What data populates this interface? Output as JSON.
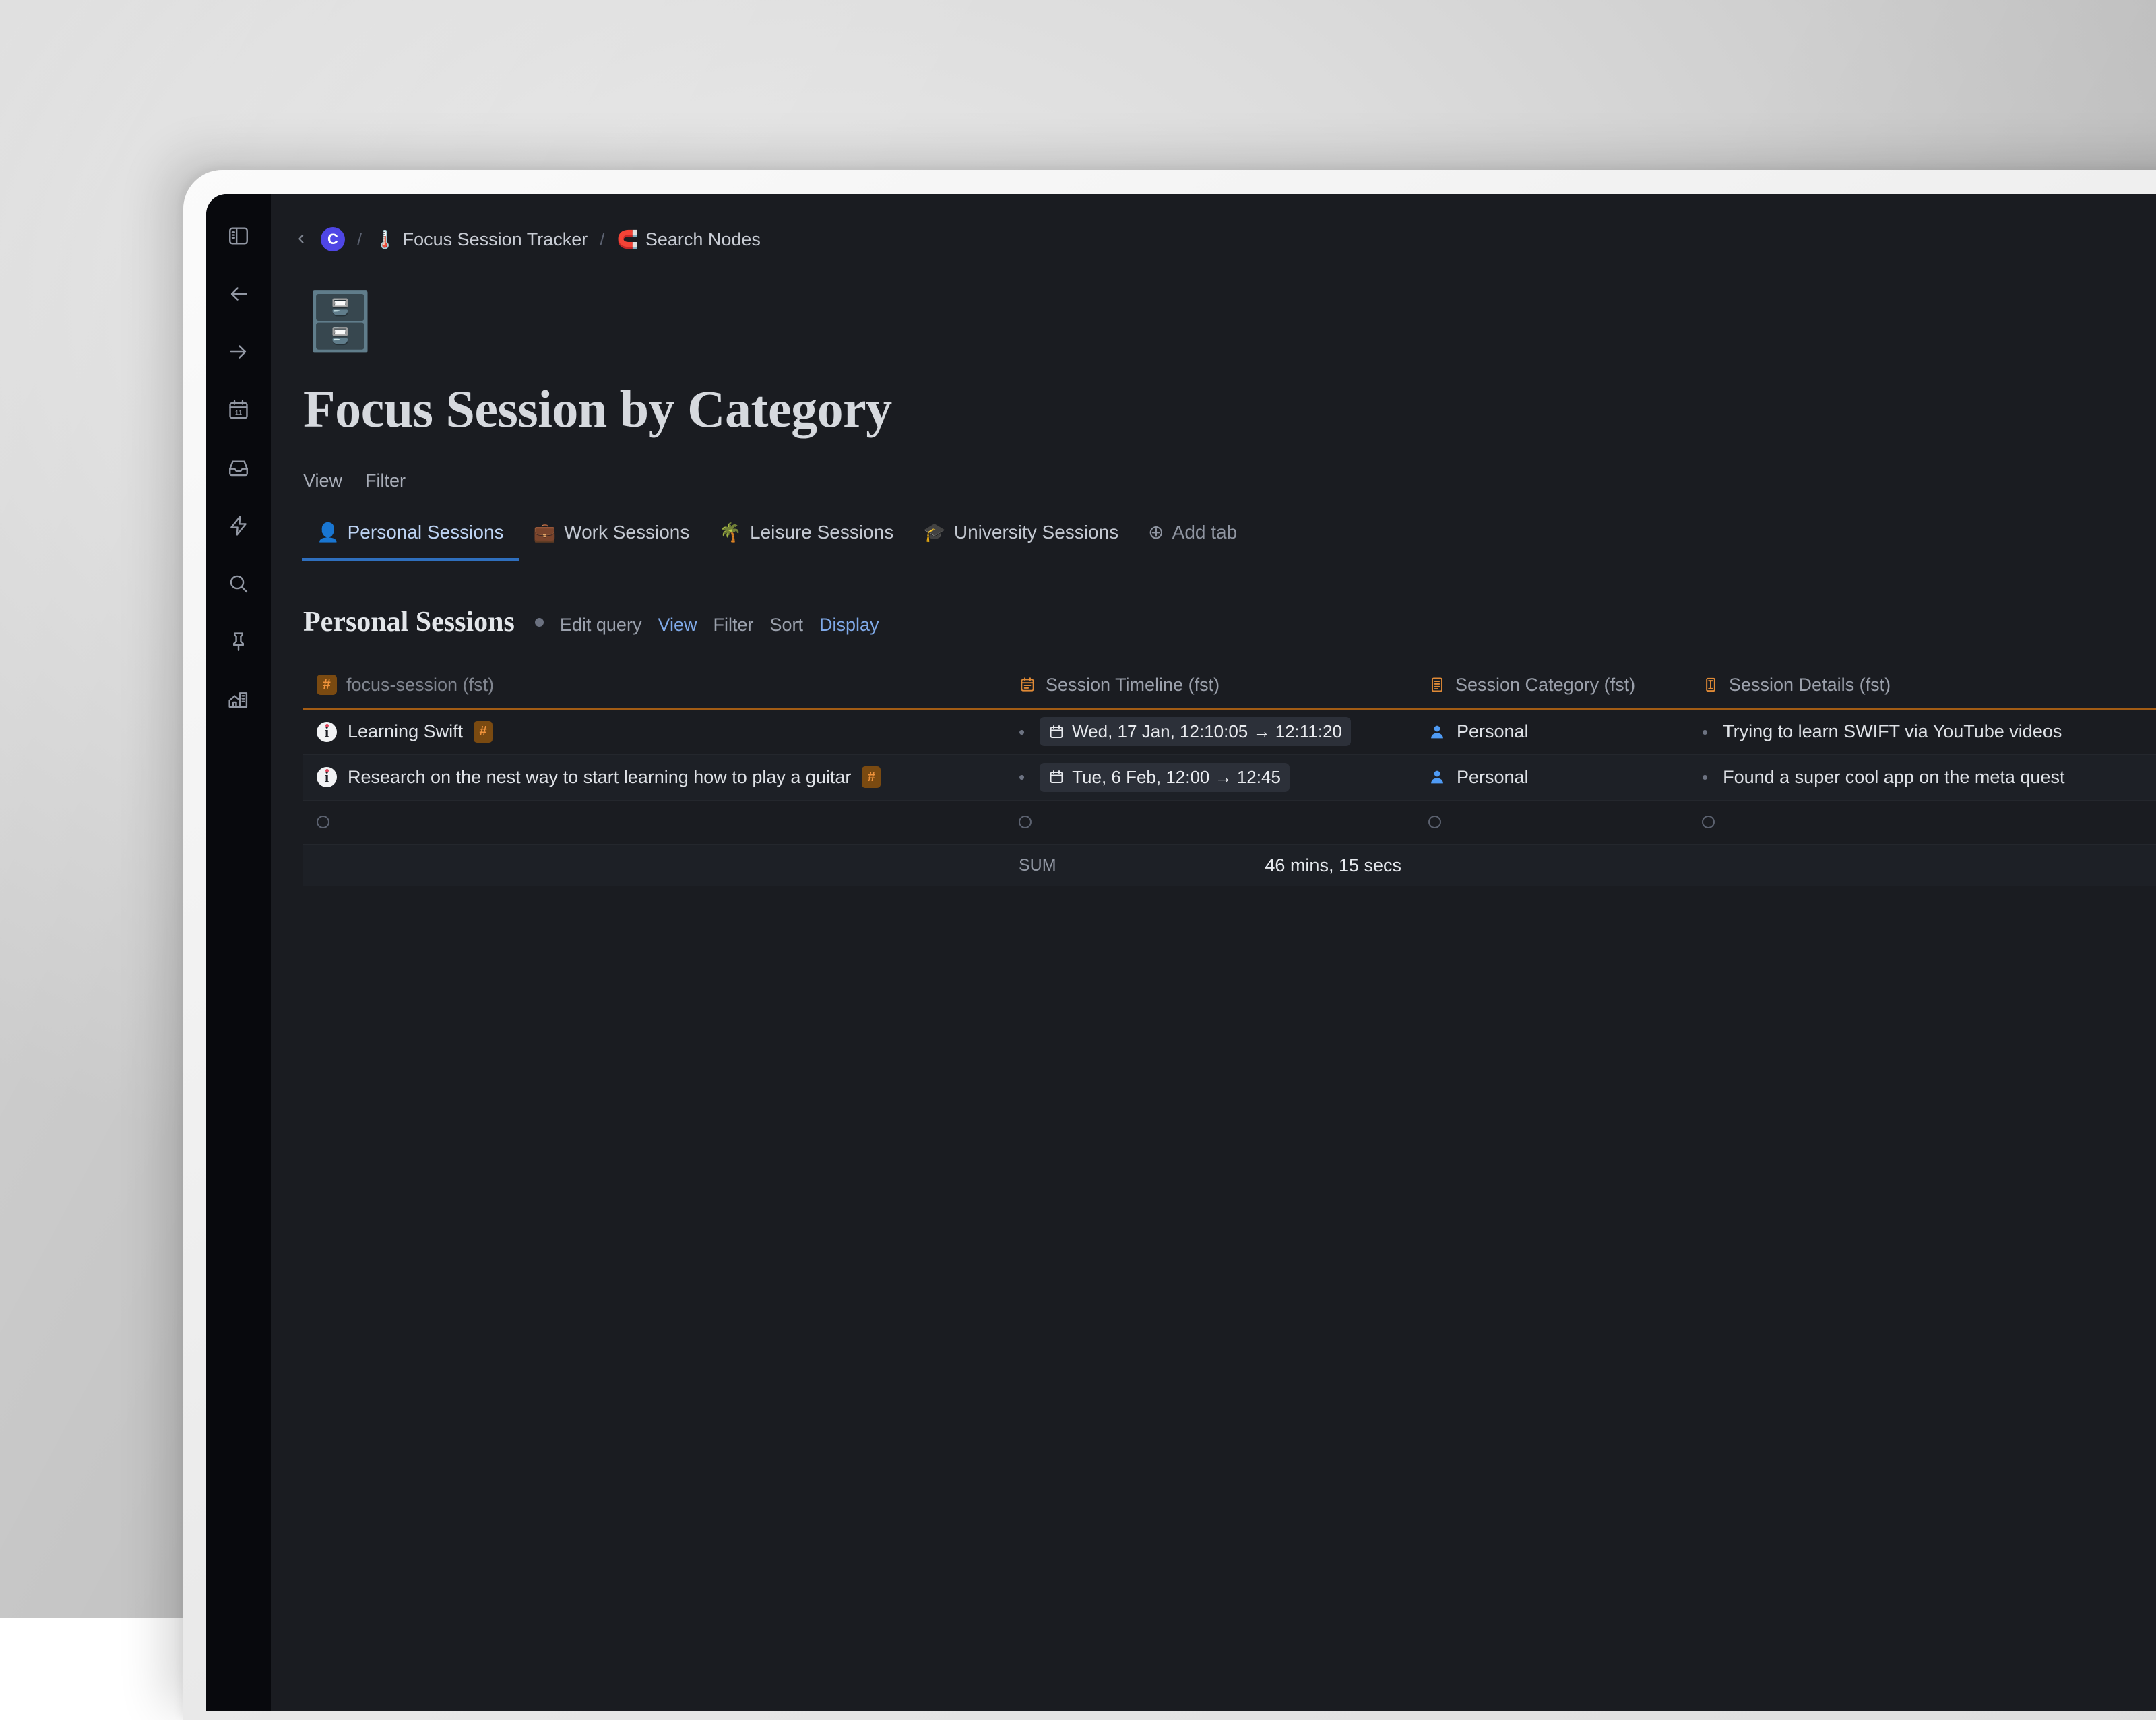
{
  "breadcrumb": {
    "back_label": "‹",
    "avatar_initial": "C",
    "separator": "/",
    "items": [
      {
        "emoji": "🌡️",
        "label": "Focus Session Tracker",
        "icon_name": "thermometer-icon"
      },
      {
        "emoji": "🧲",
        "label": "Search Nodes",
        "icon_name": "magnet-icon"
      }
    ]
  },
  "page": {
    "icon_emoji": "🗄️",
    "icon_name": "file-cabinet-icon",
    "title": "Focus Session by Category"
  },
  "viewbar": {
    "items": [
      "View",
      "Filter"
    ]
  },
  "tabs": [
    {
      "emoji": "👤",
      "label": "Personal Sessions",
      "active": true
    },
    {
      "emoji": "💼",
      "label": "Work Sessions",
      "active": false
    },
    {
      "emoji": "🌴",
      "label": "Leisure Sessions",
      "active": false
    },
    {
      "emoji": "🎓",
      "label": "University Sessions",
      "active": false
    }
  ],
  "add_tab": {
    "label": "Add tab",
    "icon": "⊕"
  },
  "section": {
    "title": "Personal Sessions",
    "links": [
      {
        "label": "Edit query",
        "accent": false
      },
      {
        "label": "View",
        "accent": true
      },
      {
        "label": "Filter",
        "accent": false
      },
      {
        "label": "Sort",
        "accent": false
      },
      {
        "label": "Display",
        "accent": true
      }
    ]
  },
  "table": {
    "columns": [
      {
        "label": "focus-session (fst)",
        "icon": "hash",
        "muted": true
      },
      {
        "label": "Session Timeline (fst)",
        "icon": "calendar",
        "muted": false
      },
      {
        "label": "Session Category (fst)",
        "icon": "list",
        "muted": false
      },
      {
        "label": "Session Details (fst)",
        "icon": "text",
        "muted": false
      }
    ],
    "rows": [
      {
        "title": "Learning Swift",
        "title_badge": "#",
        "timeline": "Wed, 17 Jan, 12:10:05 → 12:11:20",
        "category": "Personal",
        "details": "Trying to learn SWIFT via YouTube videos"
      },
      {
        "title": "Research on the nest way to start learning how to play a guitar",
        "title_badge": "#",
        "timeline": "Tue, 6 Feb, 12:00 → 12:45",
        "category": "Personal",
        "details": "Found a super cool app on the meta quest"
      }
    ],
    "footer": {
      "label": "SUM",
      "value": "46 mins, 15 secs"
    }
  },
  "sidebar": {
    "items": [
      {
        "name": "sidebar-toggle-icon",
        "label": "Toggle sidebar"
      },
      {
        "name": "arrow-left-icon",
        "label": "Back"
      },
      {
        "name": "arrow-right-icon",
        "label": "Forward"
      },
      {
        "name": "calendar-icon",
        "label": "Calendar",
        "day": "11"
      },
      {
        "name": "inbox-icon",
        "label": "Inbox"
      },
      {
        "name": "lightning-icon",
        "label": "Quick actions"
      },
      {
        "name": "search-icon",
        "label": "Search"
      },
      {
        "name": "pin-icon",
        "label": "Pinned"
      },
      {
        "name": "home-building-icon",
        "label": "Workspace"
      }
    ]
  },
  "colors": {
    "app_background": "#1a1c21",
    "rail_background": "#08090d",
    "accent_blue": "#7fa9e8",
    "accent_orange": "#f0933b",
    "row_border_orange": "#a35c14",
    "avatar_purple": "#4f46e5"
  }
}
